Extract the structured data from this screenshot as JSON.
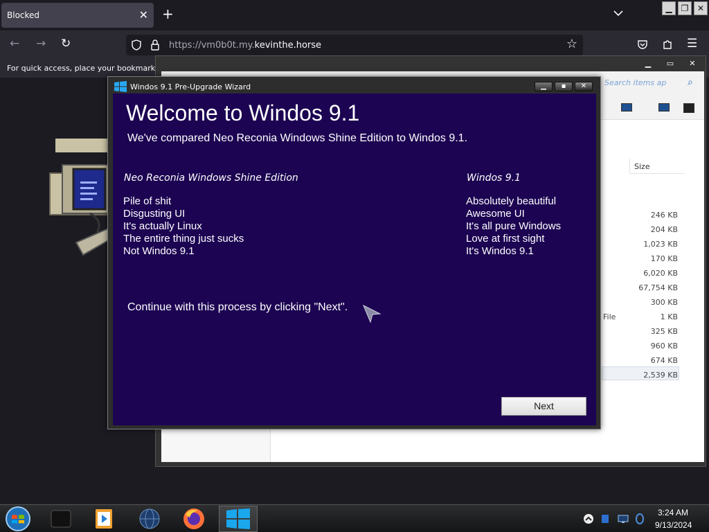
{
  "browser": {
    "tab_title": "Blocked",
    "url_prefix": "https://vm0b0t.my.",
    "url_domain": "kevinthe.horse",
    "bookmarks_hint": "For quick access, place your bookmarks he"
  },
  "explorer": {
    "search_hint": "Search items ap",
    "size_header": "Size",
    "type_fragment": "File",
    "sizes": [
      "246 KB",
      "204 KB",
      "1,023 KB",
      "170 KB",
      "6,020 KB",
      "67,754 KB",
      "300 KB",
      "1 KB",
      "325 KB",
      "960 KB",
      "674 KB",
      "2,539 KB"
    ]
  },
  "wizard": {
    "window_title": "Windos 9.1 Pre-Upgrade Wizard",
    "heading": "Welcome to Windos 9.1",
    "subheading": "We've compared Neo Reconia Windows Shine Edition  to Windos 9.1.",
    "left_header": "Neo Reconia Windows Shine Edition",
    "right_header": "Windos 9.1",
    "left_items": [
      "Pile of shit",
      "Disgusting UI",
      "It's actually Linux",
      "The entire thing just sucks",
      "Not Windos 9.1"
    ],
    "right_items": [
      "Absolutely beautiful",
      "Awesome UI",
      "It's all pure Windows",
      "Love at first sight",
      "It's Windos 9.1"
    ],
    "continue_text": "Continue with this process by clicking \"Next\".",
    "next_label": "Next"
  },
  "taskbar": {
    "time": "3:24 AM",
    "date": "9/13/2024"
  },
  "colors": {
    "wizard_bg": "#1c0452",
    "browser_bg": "#1c1b22",
    "accent_blue": "#0078d7"
  }
}
